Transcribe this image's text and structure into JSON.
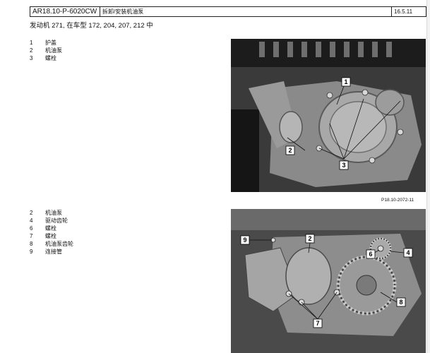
{
  "header": {
    "doc_number": "AR18.10-P-6020CW",
    "title": "拆卸/安装机油泵",
    "date": "16.5.11"
  },
  "subheading": "发动机    271, 在车型 172, 204, 207, 212 中",
  "legend_1": [
    {
      "num": "1",
      "label": "护盖"
    },
    {
      "num": "2",
      "label": "机油泵"
    },
    {
      "num": "3",
      "label": "螺栓"
    }
  ],
  "legend_2": [
    {
      "num": "2",
      "label": "机油泵"
    },
    {
      "num": "4",
      "label": "驱动齿轮"
    },
    {
      "num": "6",
      "label": "螺栓"
    },
    {
      "num": "7",
      "label": "螺栓"
    },
    {
      "num": "8",
      "label": "机油泵齿轮"
    },
    {
      "num": "9",
      "label": "连接管"
    }
  ],
  "figure_1": {
    "callouts": [
      "1",
      "2",
      "3"
    ],
    "reference": "P18.10-2072-11"
  },
  "figure_2": {
    "callouts": [
      "9",
      "2",
      "6",
      "4",
      "8",
      "7"
    ]
  }
}
